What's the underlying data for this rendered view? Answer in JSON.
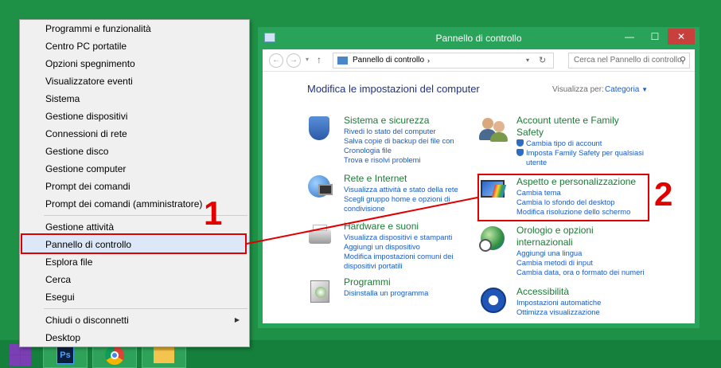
{
  "context_menu": {
    "items": [
      {
        "label": "Programmi e funzionalità"
      },
      {
        "label": "Centro PC portatile"
      },
      {
        "label": "Opzioni spegnimento"
      },
      {
        "label": "Visualizzatore eventi"
      },
      {
        "label": "Sistema"
      },
      {
        "label": "Gestione dispositivi"
      },
      {
        "label": "Connessioni di rete"
      },
      {
        "label": "Gestione disco"
      },
      {
        "label": "Gestione computer"
      },
      {
        "label": "Prompt dei comandi"
      },
      {
        "label": "Prompt dei comandi (amministratore)"
      },
      {
        "label": "Gestione attività"
      },
      {
        "label": "Pannello di controllo"
      },
      {
        "label": "Esplora file"
      },
      {
        "label": "Cerca"
      },
      {
        "label": "Esegui"
      },
      {
        "label": "Chiudi o disconnetti"
      },
      {
        "label": "Desktop"
      }
    ]
  },
  "window": {
    "title": "Pannello di controllo",
    "minimize": "—",
    "maximize": "☐",
    "close": "✕",
    "address": "Pannello di controllo",
    "search_placeholder": "Cerca nel Pannello di controllo",
    "heading": "Modifica le impostazioni del computer",
    "view_by_label": "Visualizza per:",
    "view_by_value": "Categoria"
  },
  "categories": {
    "sistema": {
      "title": "Sistema e sicurezza",
      "links": [
        "Rivedi lo stato del computer",
        "Salva copie di backup dei file con",
        "Cronologia file",
        "Trova e risolvi problemi"
      ]
    },
    "rete": {
      "title": "Rete e Internet",
      "links": [
        "Visualizza attività e stato della rete",
        "Scegli gruppo home e opzioni di",
        "condivisione"
      ]
    },
    "hardware": {
      "title": "Hardware e suoni",
      "links": [
        "Visualizza dispositivi e stampanti",
        "Aggiungi un dispositivo",
        "Modifica impostazioni comuni dei",
        "dispositivi portatili"
      ]
    },
    "programmi": {
      "title": "Programmi",
      "links": [
        "Disinstalla un programma"
      ]
    },
    "account": {
      "title_1": "Account utente e Family",
      "title_2": "Safety",
      "links": [
        "Cambia tipo di account",
        "Imposta Family Safety per qualsiasi",
        "utente"
      ]
    },
    "aspetto": {
      "title": "Aspetto e personalizzazione",
      "links": [
        "Cambia tema",
        "Cambia lo sfondo del desktop",
        "Modifica risoluzione dello schermo"
      ]
    },
    "orologio": {
      "title_1": "Orologio e opzioni",
      "title_2": "internazionali",
      "links": [
        "Aggiungi una lingua",
        "Cambia metodi di input",
        "Cambia data, ora o formato dei numeri"
      ]
    },
    "accessibilita": {
      "title": "Accessibilità",
      "links": [
        "Impostazioni automatiche",
        "Ottimizza visualizzazione"
      ]
    }
  },
  "annotations": {
    "step1": "1",
    "step2": "2"
  },
  "colors": {
    "desktop": "#1f9146",
    "annotation": "#e00000",
    "link": "#1a5bc4",
    "category_title": "#1e7a37"
  }
}
